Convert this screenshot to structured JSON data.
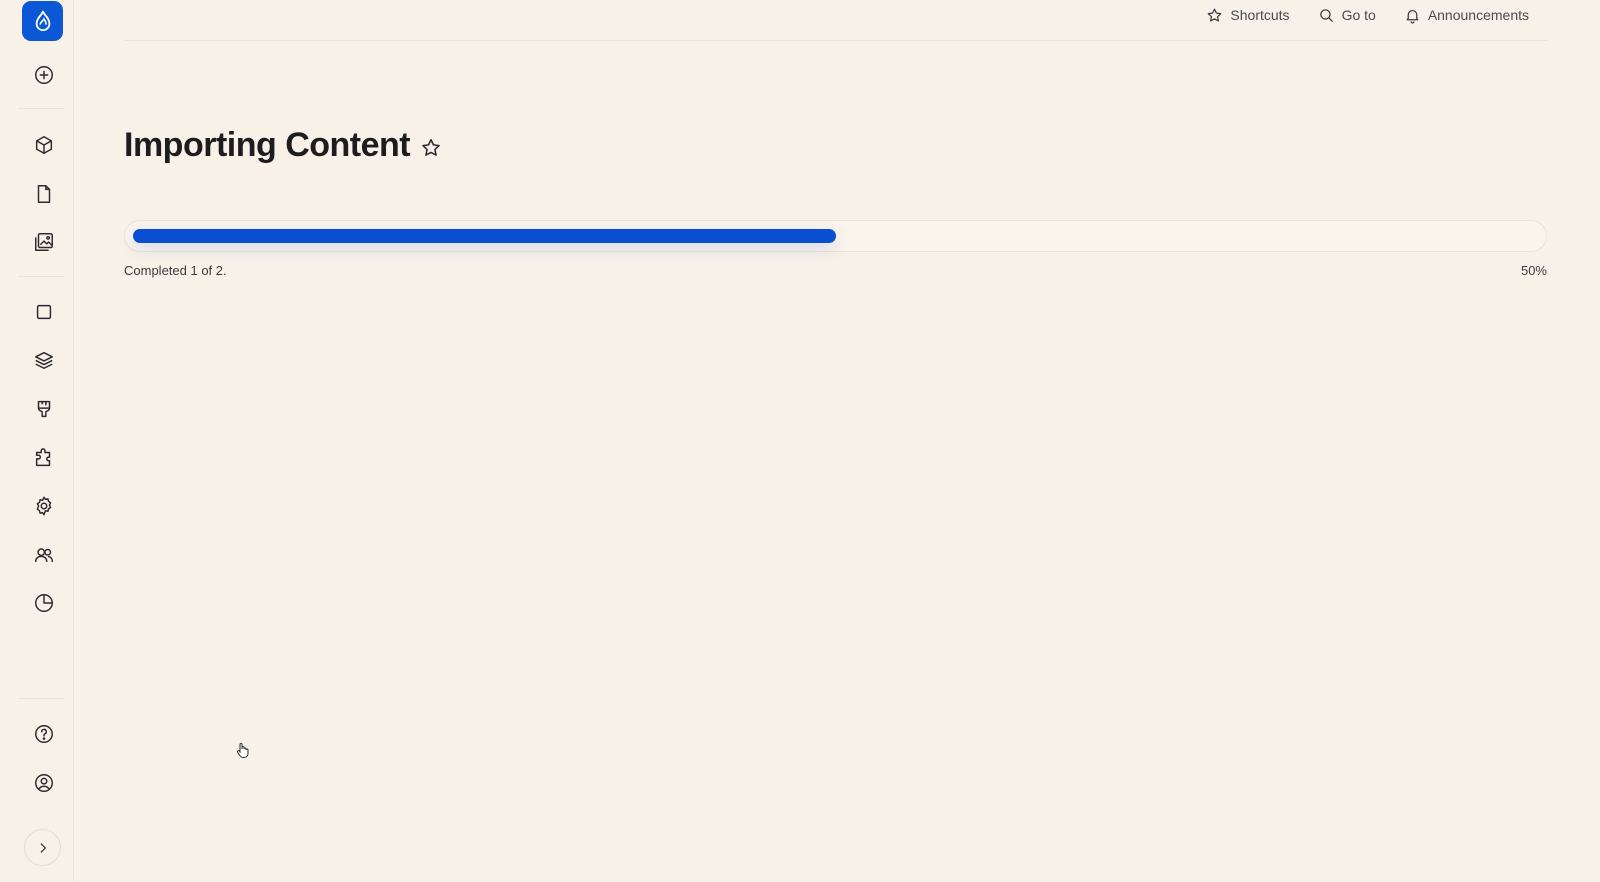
{
  "header": {
    "actions": [
      {
        "label": "Shortcuts",
        "icon": "star-icon"
      },
      {
        "label": "Go to",
        "icon": "search-icon"
      },
      {
        "label": "Announcements",
        "icon": "bell-icon"
      }
    ]
  },
  "sidebar": {
    "logo_icon": "drupal-drop-icon",
    "items": [
      {
        "name": "add",
        "icon": "plus-circle-icon"
      },
      {
        "name": "content-types",
        "icon": "cube-icon"
      },
      {
        "name": "content",
        "icon": "document-icon"
      },
      {
        "name": "media",
        "icon": "images-icon"
      },
      {
        "name": "blocks",
        "icon": "square-icon"
      },
      {
        "name": "structure",
        "icon": "layers-icon"
      },
      {
        "name": "appearance",
        "icon": "brush-icon"
      },
      {
        "name": "extend",
        "icon": "puzzle-icon"
      },
      {
        "name": "configuration",
        "icon": "gear-icon"
      },
      {
        "name": "people",
        "icon": "users-icon"
      },
      {
        "name": "reports",
        "icon": "pie-chart-icon"
      }
    ],
    "bottom_items": [
      {
        "name": "help",
        "icon": "help-circle-icon"
      },
      {
        "name": "user",
        "icon": "user-circle-icon"
      }
    ],
    "expand_icon": "chevron-right-icon"
  },
  "main": {
    "title": "Importing Content",
    "progress": {
      "fraction": 0.5,
      "label": "Completed 1 of 2.",
      "percent_text": "50%"
    }
  },
  "colors": {
    "accent": "#0a4fd1",
    "background": "#f8f1e8"
  }
}
